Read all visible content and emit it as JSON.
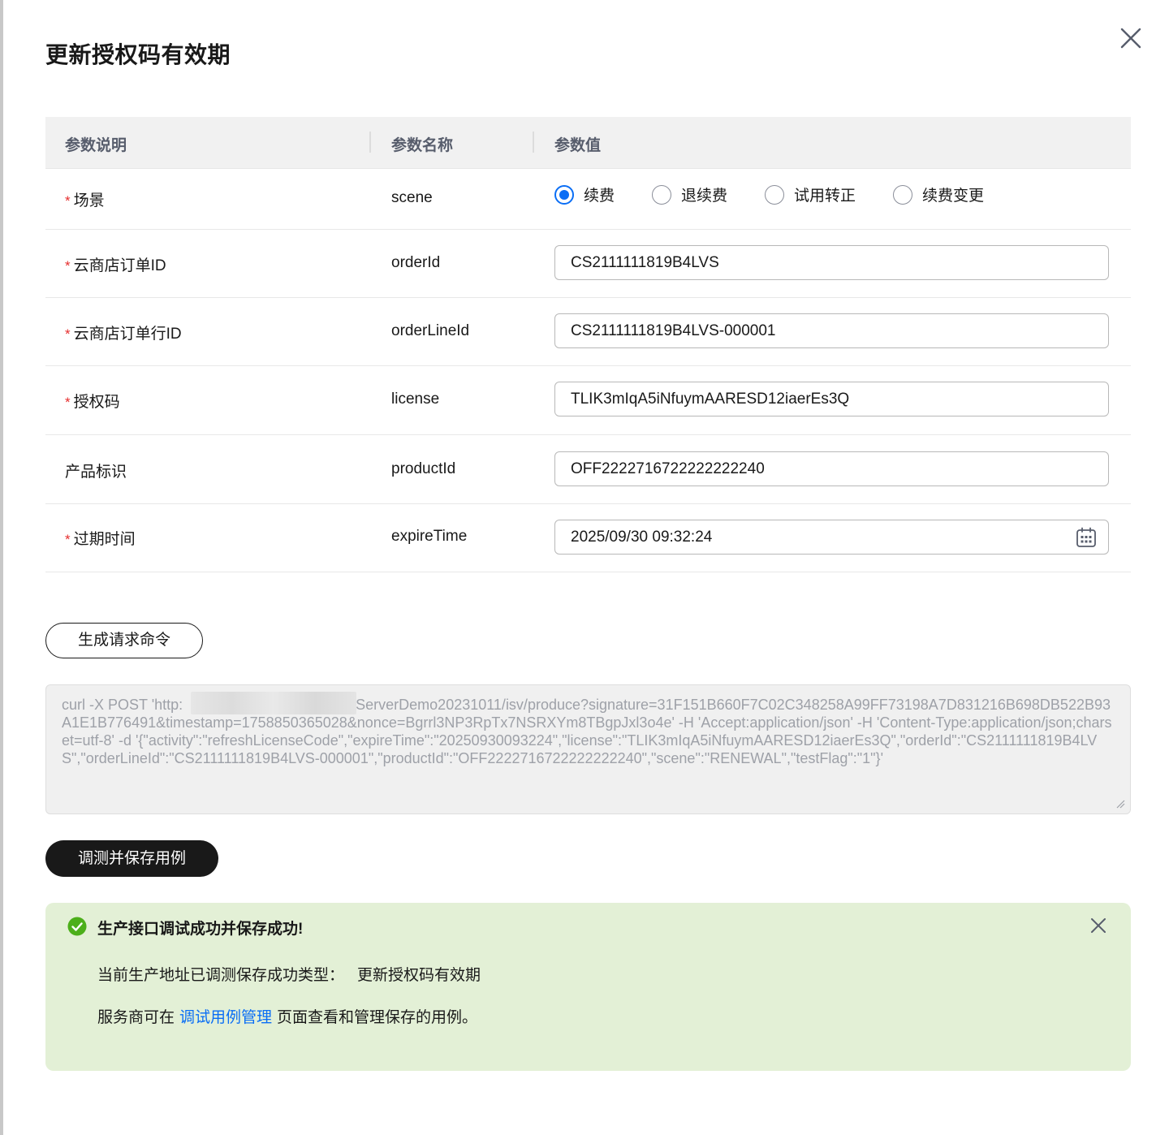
{
  "dialog": {
    "title": "更新授权码有效期"
  },
  "table": {
    "headers": [
      "参数说明",
      "参数名称",
      "参数值"
    ],
    "rows": [
      {
        "required": true,
        "desc": "场景",
        "name": "scene"
      },
      {
        "required": true,
        "desc": "云商店订单ID",
        "name": "orderId",
        "value": "CS2111111819B4LVS"
      },
      {
        "required": true,
        "desc": "云商店订单行ID",
        "name": "orderLineId",
        "value": "CS2111111819B4LVS-000001"
      },
      {
        "required": true,
        "desc": "授权码",
        "name": "license",
        "value": "TLIK3mIqA5iNfuymAARESD12iaerEs3Q"
      },
      {
        "required": false,
        "desc": "产品标识",
        "name": "productId",
        "value": "OFF2222716722222222240"
      },
      {
        "required": true,
        "desc": "过期时间",
        "name": "expireTime",
        "value": "2025/09/30 09:32:24"
      }
    ],
    "required_mark": "*",
    "scene_options": [
      {
        "label": "续费",
        "checked": true
      },
      {
        "label": "退续费",
        "checked": false
      },
      {
        "label": "试用转正",
        "checked": false
      },
      {
        "label": "续费变更",
        "checked": false
      }
    ]
  },
  "generate_button": "生成请求命令",
  "command": {
    "prefix": "curl -X POST 'http:",
    "text": "sServerDemo20231011/isv/produce?signature=31F151B660F7C02C348258A99FF73198A7D831216B698DB522B93A1E1B776491&timestamp=1758850365028&nonce=Bgrrl3NP3RpTx7NSRXYm8TBgpJxl3o4e' -H 'Accept:application/json' -H 'Content-Type:application/json;charset=utf-8' -d '{\"activity\":\"refreshLicenseCode\",\"expireTime\":\"20250930093224\",\"license\":\"TLIK3mIqA5iNfuymAARESD12iaerEs3Q\",\"orderId\":\"CS2111111819B4LVS\",\"orderLineId\":\"CS2111111819B4LVS-000001\",\"productId\":\"OFF2222716722222222240\",\"scene\":\"RENEWAL\",\"testFlag\":\"1\"}'"
  },
  "test_button": "调测并保存用例",
  "alert": {
    "title": "生产接口调试成功并保存成功!",
    "line1_label": "当前生产地址已调测保存成功类型：",
    "line1_value": "更新授权码有效期",
    "line2_prefix": "服务商可在",
    "line2_link": "调试用例管理",
    "line2_suffix": "页面查看和管理保存的用例。"
  },
  "colors": {
    "accent": "#0a6ef5",
    "required": "#e62e2e",
    "success_bg": "#e3f0d6",
    "success_icon": "#4caf1a",
    "primary_button": "#191919"
  },
  "icons": {
    "close": "close-icon",
    "calendar": "calendar-icon",
    "success": "check-circle-icon",
    "alert_close": "close-icon"
  }
}
